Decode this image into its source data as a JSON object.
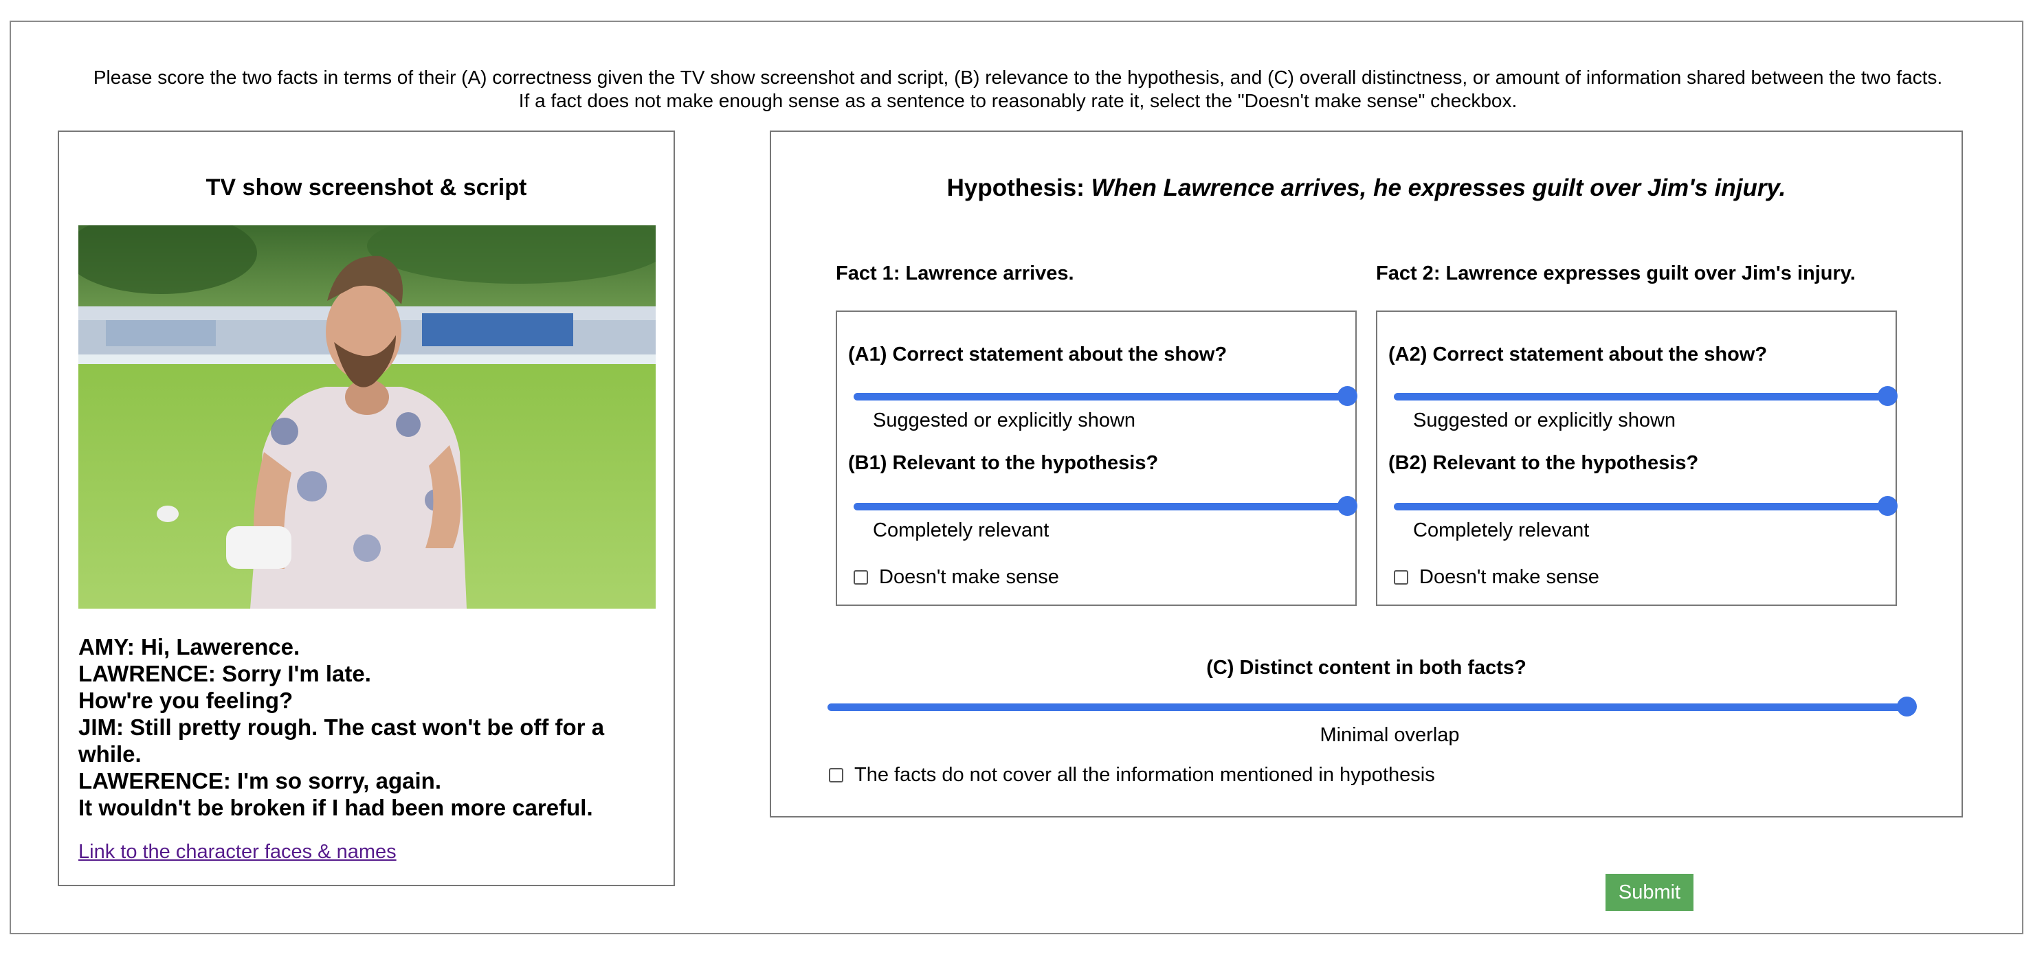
{
  "instructions": {
    "line1": "Please score the two facts in terms of their (A) correctness given the TV show screenshot and script, (B) relevance to the hypothesis, and (C) overall distinctness, or amount of information shared between the two facts.",
    "line2": "If a fact does not make enough sense as a sentence to reasonably rate it, select the \"Doesn't make sense\" checkbox."
  },
  "left": {
    "title": "TV show screenshot & script",
    "script_lines": [
      "AMY: Hi, Lawerence.",
      "LAWRENCE: Sorry I'm late.",
      "How're you feeling?",
      "JIM: Still pretty rough. The cast won't be off for a while.",
      "LAWERENCE: I'm so sorry, again.",
      "It wouldn't be broken if I had been more careful."
    ],
    "link": "Link to the character faces & names"
  },
  "hypothesis": {
    "label": "Hypothesis:",
    "text": "When Lawrence arrives, he expresses guilt over Jim's injury."
  },
  "facts": [
    {
      "heading": "Fact 1: Lawrence arrives.",
      "q_correct": "(A1) Correct statement about the show?",
      "correct_value": "Suggested or explicitly shown",
      "correct_level": 1.0,
      "q_relevant": "(B1) Relevant to the hypothesis?",
      "relevant_value": "Completely relevant",
      "relevant_level": 1.0,
      "checkbox": "Doesn't make sense",
      "checked": false
    },
    {
      "heading": "Fact 2: Lawrence expresses guilt over Jim's injury.",
      "q_correct": "(A2) Correct statement about the show?",
      "correct_value": "Suggested or explicitly shown",
      "correct_level": 1.0,
      "q_relevant": "(B2) Relevant to the hypothesis?",
      "relevant_value": "Completely relevant",
      "relevant_level": 1.0,
      "checkbox": "Doesn't make sense",
      "checked": false
    }
  ],
  "distinct": {
    "label": "(C) Distinct content in both facts?",
    "value": "Minimal overlap",
    "level": 1.0
  },
  "coverage_checkbox": "The facts do not cover all the information mentioned in hypothesis",
  "submit_label": "Submit",
  "colors": {
    "slider": "#3b73e6",
    "submit": "#5aa85a",
    "link": "#551a8b"
  }
}
